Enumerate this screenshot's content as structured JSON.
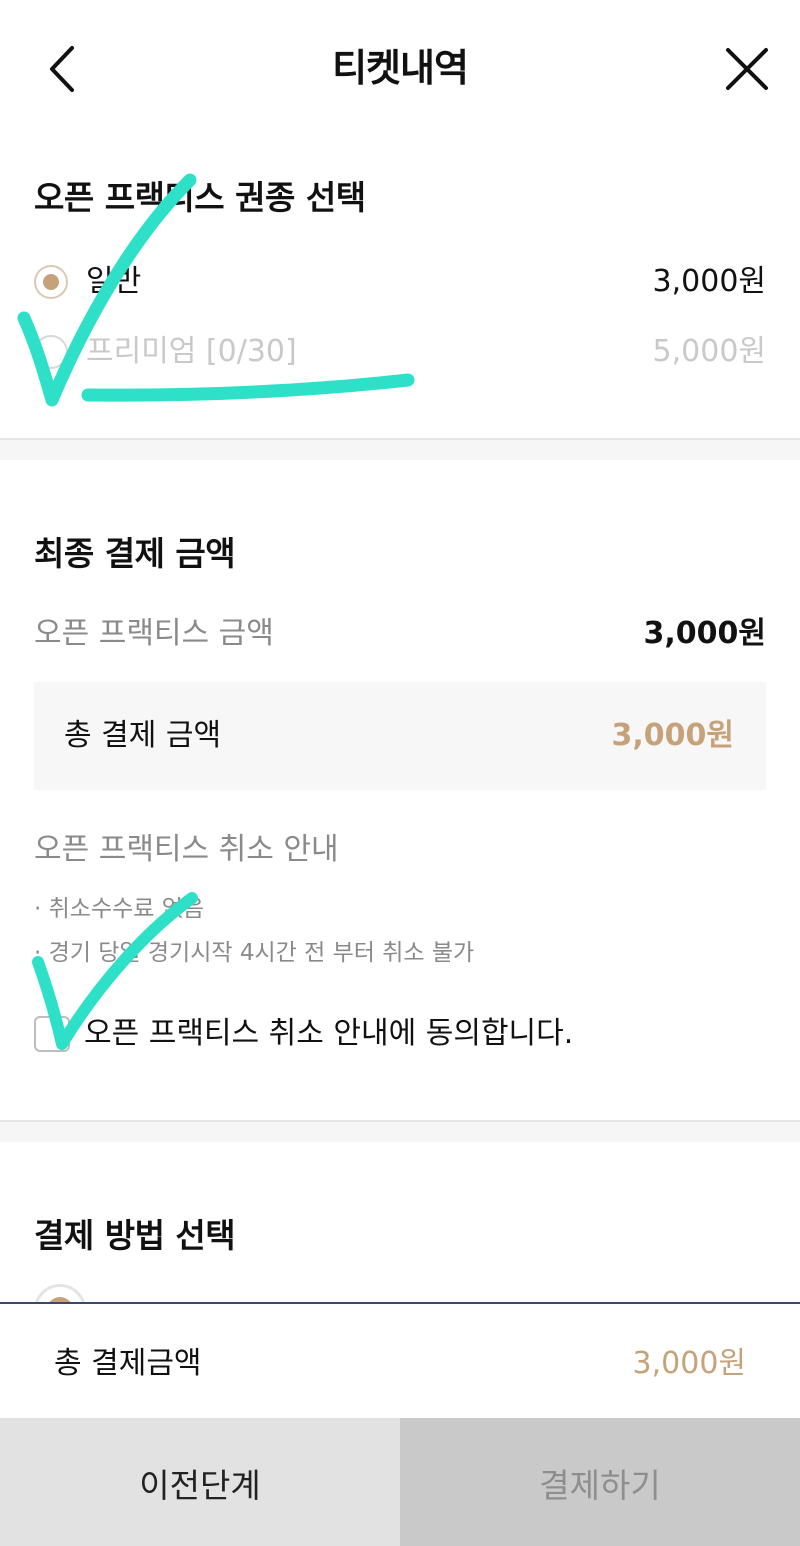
{
  "header": {
    "title": "티켓내역",
    "back_icon": "chevron-left-icon",
    "close_icon": "close-icon"
  },
  "ticket_type": {
    "title": "오픈 프랙티스 권종 선택",
    "options": [
      {
        "label": "일반",
        "price": "3,000원",
        "selected": true,
        "disabled": false
      },
      {
        "label": "프리미엄 [0/30]",
        "price": "5,000원",
        "selected": false,
        "disabled": true
      }
    ]
  },
  "final_payment": {
    "title": "최종 결제 금액",
    "line_label": "오픈 프랙티스 금액",
    "line_value": "3,000원",
    "total_label": "총 결제 금액",
    "total_value": "3,000원"
  },
  "cancel_notice": {
    "title": "오픈 프랙티스 취소 안내",
    "items": [
      "· 취소수수료 없음",
      "· 경기 당일 경기시작 4시간 전 부터 취소 불가"
    ],
    "agree_label": "오픈 프랙티스 취소 안내에 동의합니다.",
    "agreed": false
  },
  "payment_method": {
    "title": "결제 방법 선택"
  },
  "bottom_bar": {
    "total_label": "총 결제금액",
    "total_value": "3,000원",
    "prev_label": "이전단계",
    "pay_label": "결제하기"
  },
  "colors": {
    "accent": "#c6a27a",
    "annotation": "#2ee0c8",
    "muted": "#8a8a8a",
    "disabled_bg": "#c9c9c9"
  }
}
